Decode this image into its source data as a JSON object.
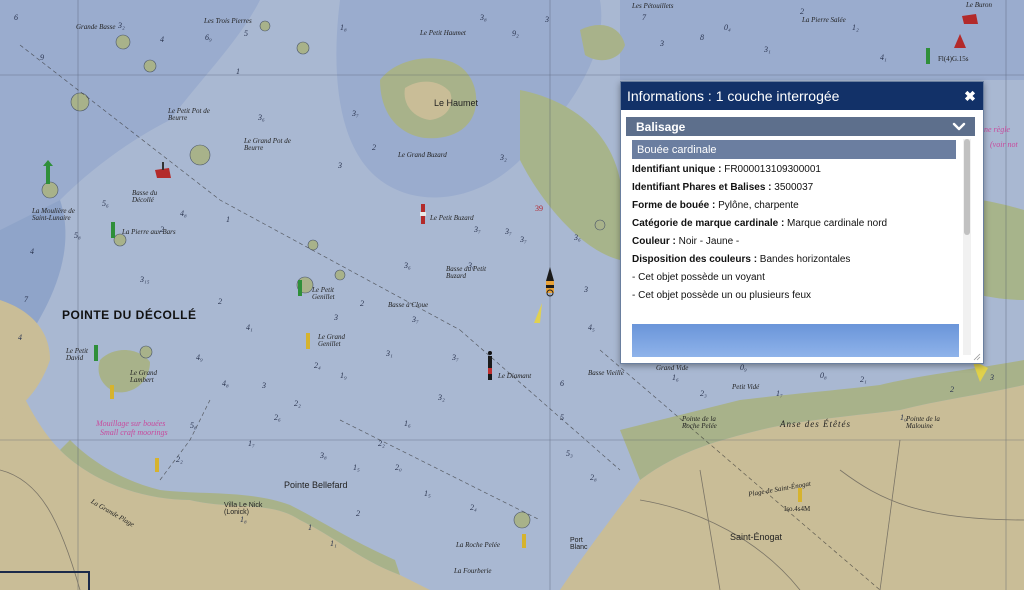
{
  "popup": {
    "title": "Informations : 1 couche interrogée",
    "close_symbol": "✖",
    "layer": {
      "name": "Balisage",
      "expanded": true
    },
    "object_title": "Bouée cardinale",
    "attributes": [
      {
        "label": "Identifiant unique :",
        "value": "FR000013109300001"
      },
      {
        "label": "Identifiant Phares et Balises :",
        "value": "3500037"
      },
      {
        "label": "Forme de bouée :",
        "value": "Pylône, charpente"
      },
      {
        "label": "Catégorie de marque cardinale :",
        "value": "Marque cardinale nord"
      },
      {
        "label": "Couleur :",
        "value": "Noir - Jaune -"
      },
      {
        "label": "Disposition des couleurs :",
        "value": "Bandes horizontales"
      }
    ],
    "notes": [
      "- Cet objet possède un voyant",
      "- Cet objet possède un ou plusieurs feux"
    ]
  },
  "map": {
    "colors": {
      "deep_water": "#a9b8d2",
      "shallow_water": "#8fa4c9",
      "land": "#c9bd97",
      "foreshore": "#a8b28a",
      "grid": "#4a5569"
    },
    "labels": {
      "pointe_du_decolle": "POINTE DU DÉCOLLÉ",
      "les_trois_pierres": "Les Trois Pierres",
      "grande_basse": "Grande Basse",
      "le_petit_haumet": "Le Petit Haumet",
      "le_haumet": "Le Haumet",
      "le_petit_pot_de_beurre": "Le Petit Pot de Beurre",
      "le_grand_pot_de_beurre": "Le Grand Pot de Beurre",
      "le_grand_buzard": "Le Grand Buzard",
      "le_petit_buzard": "Le Petit Buzard",
      "basse_du_petit_buzard": "Basse du Petit Buzard",
      "basse_du_decolle": "Basse du Décollé",
      "la_mouliere": "La Moulière de Saint-Lunaire",
      "la_pierre_aux_bars": "La Pierre aux Bars",
      "le_petit_genillet": "Le Petit Genillet",
      "basse_a_cloue": "Basse à Cloue",
      "le_grand_genillet": "Le Grand Genillet",
      "le_petit_david": "Le Petit David",
      "le_grand_lambert": "Le Grand Lambert",
      "mouillage": "Mouillage sur bouées",
      "small_craft": "Small craft moorings",
      "le_diamant": "Le Diamant",
      "basse_vieille": "Basse Vieille",
      "grand_vide": "Grand Vide",
      "petit_vide": "Petit Vidé",
      "anse_des_etetes": "Anse des Étêtés",
      "pointe_roche_pelee": "Pointe de la Roche Pelée",
      "pointe_malouine": "Pointe de la Malouine",
      "pointe_bellefard": "Pointe Bellefard",
      "la_roche_pelee": "La Roche Pelée",
      "saint_enogat": "Saint-Énogat",
      "plage_saint_enogat": "Plage de Saint-Énogat",
      "la_fourberie": "La Fourberie",
      "villa_le_nick": "Villa Le Nick (Lonick)",
      "port_blanc": "Port Blanc",
      "les_petouillets": "Les Pétouillets",
      "la_pierre_salee": "La Pierre Salée",
      "le_buron": "Le Buron",
      "la_grande_plage": "La Grande Plage",
      "les_regles": "ne règle",
      "voir_note": "(voir not",
      "iso_light": "Iso.4s4M",
      "fl_light": "Fl(4)G.15s",
      "depth_39": "39"
    }
  }
}
